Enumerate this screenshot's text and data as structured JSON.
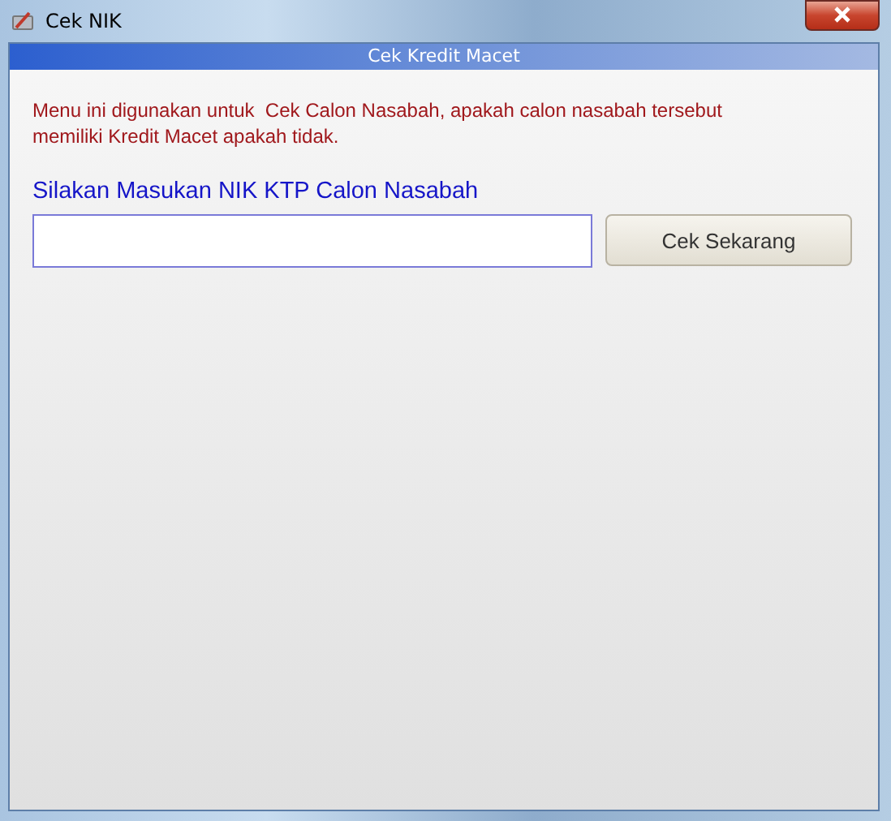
{
  "window": {
    "title": "Cek NIK"
  },
  "panel": {
    "title": "Cek Kredit Macet",
    "description": "Menu ini digunakan untuk  Cek Calon Nasabah, apakah calon nasabah tersebut memiliki Kredit Macet apakah tidak.",
    "prompt": "Silakan Masukan NIK KTP Calon Nasabah",
    "button": "Cek Sekarang"
  }
}
